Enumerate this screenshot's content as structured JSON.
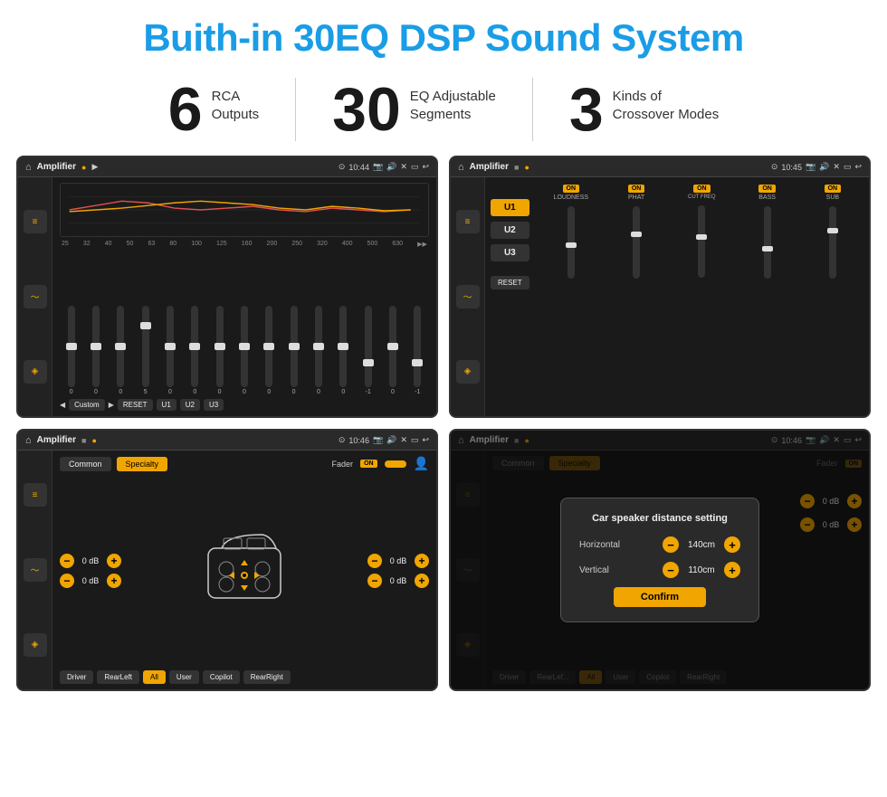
{
  "page": {
    "title": "Buith-in 30EQ DSP Sound System",
    "stats": [
      {
        "number": "6",
        "label": "RCA\nOutputs"
      },
      {
        "number": "30",
        "label": "EQ Adjustable\nSegments"
      },
      {
        "number": "3",
        "label": "Kinds of\nCrossover Modes"
      }
    ]
  },
  "screens": {
    "screen1": {
      "topbar": {
        "title": "Amplifier",
        "time": "10:44"
      },
      "freqs": [
        "25",
        "32",
        "40",
        "50",
        "63",
        "80",
        "100",
        "125",
        "160",
        "200",
        "250",
        "320",
        "400",
        "500",
        "630"
      ],
      "values": [
        "0",
        "0",
        "0",
        "5",
        "0",
        "0",
        "0",
        "0",
        "0",
        "0",
        "0",
        "0",
        "-1",
        "0",
        "-1"
      ],
      "presets": [
        "Custom",
        "RESET",
        "U1",
        "U2",
        "U3"
      ]
    },
    "screen2": {
      "topbar": {
        "title": "Amplifier",
        "time": "10:45"
      },
      "presets": [
        "U1",
        "U2",
        "U3"
      ],
      "channels": [
        "LOUDNESS",
        "PHAT",
        "CUT FREQ",
        "BASS",
        "SUB"
      ],
      "reset": "RESET"
    },
    "screen3": {
      "topbar": {
        "title": "Amplifier",
        "time": "10:46"
      },
      "tabs": [
        "Common",
        "Specialty"
      ],
      "fader": "Fader",
      "fader_on": "ON",
      "db_values": [
        "0 dB",
        "0 dB",
        "0 dB",
        "0 dB"
      ],
      "buttons": [
        "Driver",
        "RearLeft",
        "All",
        "User",
        "Copilot",
        "RearRight"
      ]
    },
    "screen4": {
      "topbar": {
        "title": "Amplifier",
        "time": "10:46"
      },
      "tabs": [
        "Common",
        "Specialty"
      ],
      "dialog": {
        "title": "Car speaker distance setting",
        "horizontal_label": "Horizontal",
        "horizontal_value": "140cm",
        "vertical_label": "Vertical",
        "vertical_value": "110cm",
        "confirm_label": "Confirm"
      },
      "db_values": [
        "0 dB",
        "0 dB"
      ],
      "buttons": [
        "Driver",
        "RearLef...",
        "All",
        "User",
        "Copilot",
        "RearRight"
      ]
    }
  }
}
